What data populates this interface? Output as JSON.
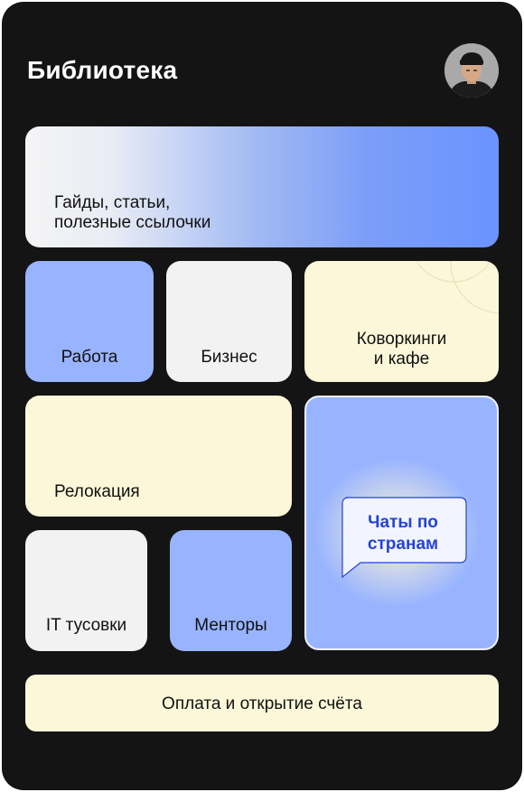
{
  "header": {
    "title": "Библиотека",
    "avatar_icon": "user-avatar-photo"
  },
  "cards": {
    "guides": "Гайды, статьи,\nполезные ссылочки",
    "work": "Работа",
    "business": "Бизнес",
    "coworking": "Коворкинги\nи кафе",
    "relocation": "Релокация",
    "chats": "Чаты по\nстранам",
    "it_meetups": "IT тусовки",
    "mentors": "Менторы",
    "payment": "Оплата и открытие счёта"
  },
  "colors": {
    "background": "#141414",
    "blue_card": "#98b4ff",
    "grey_card": "#f2f2f2",
    "cream_card": "#fbf7d8",
    "chat_text": "#2443d6"
  }
}
